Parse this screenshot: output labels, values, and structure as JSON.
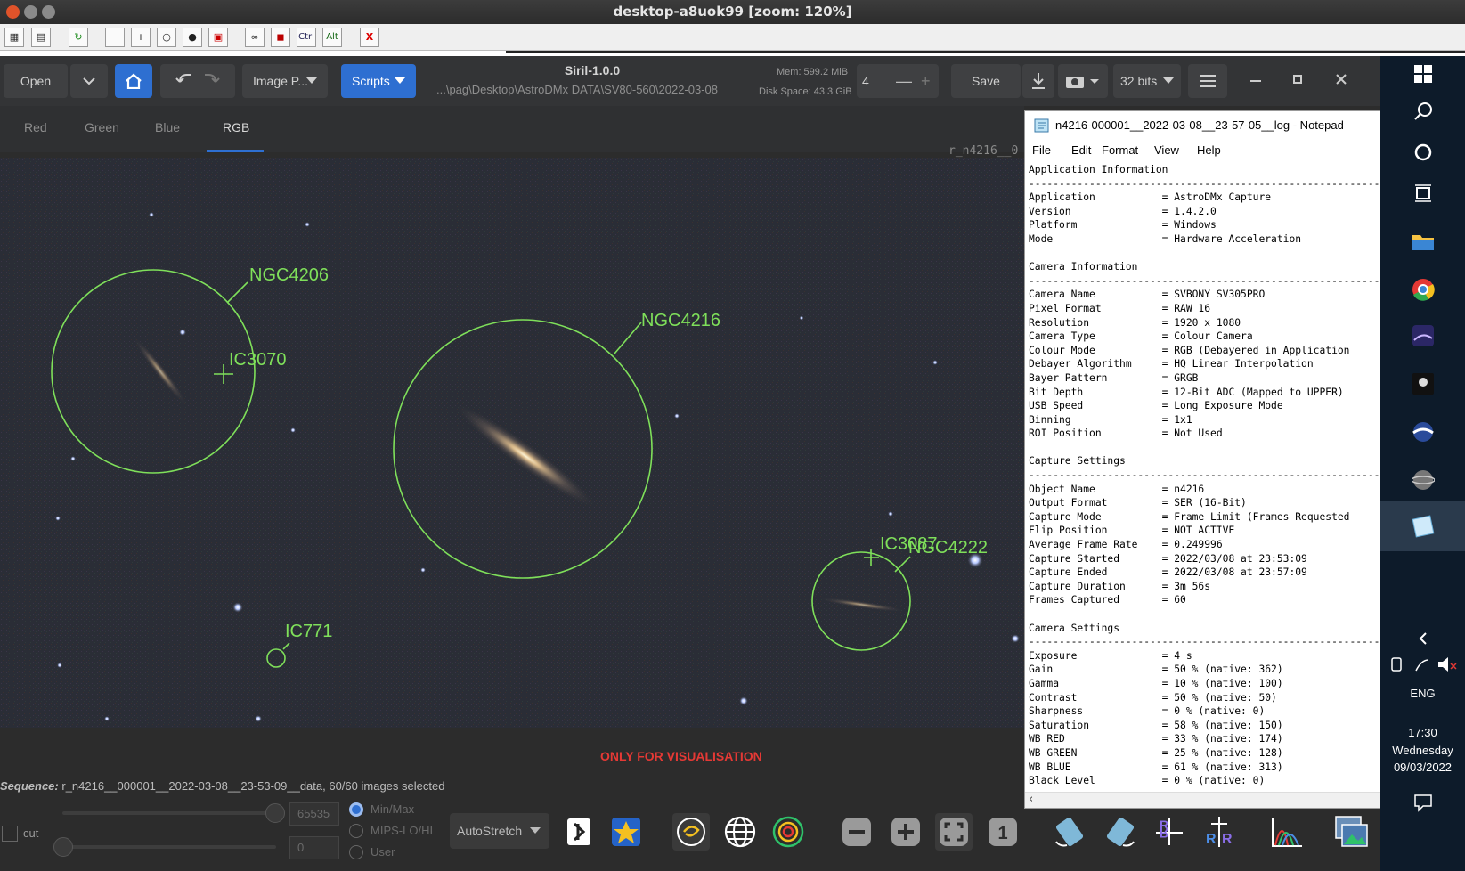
{
  "vnc": {
    "title": "desktop-a8uok99 [zoom: 120%]",
    "toolbar": [
      "clipboard-icon",
      "file-icon",
      "refresh-icon",
      "zoom-out-icon",
      "zoom-in-icon",
      "zoom-fit-icon",
      "zoom-100-icon",
      "fullscreen-icon",
      "link-icon",
      "screen-icon"
    ],
    "ctrl": "Ctrl",
    "alt": "Alt",
    "close": "X"
  },
  "siril": {
    "open": "Open",
    "image_processing": "Image P...",
    "scripts": "Scripts",
    "title": "Siril-1.0.0",
    "path": "...\\pag\\Desktop\\AstroDMx DATA\\SV80-560\\2022-03-08",
    "mem": "Mem: 599.2 MiB",
    "disk": "Disk Space: 43.3 GiB",
    "spin_value": "4",
    "save": "Save",
    "bits": "32 bits",
    "tabs": [
      "Red",
      "Green",
      "Blue",
      "RGB"
    ],
    "image_name": "r_n4216__0",
    "vis_label": "ONLY FOR VISUALISATION",
    "sequence_label": "Sequence:",
    "sequence_text": " r_n4216__000001__2022-03-08__23-53-09__data, 60/60 images selected",
    "max_value": "65535",
    "min_value": "0",
    "minmax": "Min/Max",
    "mips": "MIPS-LO/HI",
    "user": "User",
    "cut": "cut",
    "autostretch": "AutoStretch",
    "one": "1",
    "objects": [
      {
        "name": "NGC4206"
      },
      {
        "name": "IC3070"
      },
      {
        "name": "NGC4216"
      },
      {
        "name": "IC3087"
      },
      {
        "name": "NGC4222"
      },
      {
        "name": "IC771"
      }
    ]
  },
  "notepad": {
    "title": "n4216-000001__2022-03-08__23-57-05__log - Notepad",
    "menu": [
      "File",
      "Edit",
      "Format",
      "View",
      "Help"
    ],
    "lines": [
      "Application Information",
      "------------------------------------------------------------",
      "Application           = AstroDMx Capture",
      "Version               = 1.4.2.0",
      "Platform              = Windows",
      "Mode                  = Hardware Acceleration",
      "",
      "Camera Information",
      "------------------------------------------------------------",
      "Camera Name           = SVBONY SV305PRO",
      "Pixel Format          = RAW 16",
      "Resolution            = 1920 x 1080",
      "Camera Type           = Colour Camera",
      "Colour Mode           = RGB (Debayered in Application",
      "Debayer Algorithm     = HQ Linear Interpolation",
      "Bayer Pattern         = GRGB",
      "Bit Depth             = 12-Bit ADC (Mapped to UPPER)",
      "USB Speed             = Long Exposure Mode",
      "Binning               = 1x1",
      "ROI Position          = Not Used",
      "",
      "Capture Settings",
      "------------------------------------------------------------",
      "Object Name           = n4216",
      "Output Format         = SER (16-Bit)",
      "Capture Mode          = Frame Limit (Frames Requested",
      "Flip Position         = NOT ACTIVE",
      "Average Frame Rate    = 0.249996",
      "Capture Started       = 2022/03/08 at 23:53:09",
      "Capture Ended         = 2022/03/08 at 23:57:09",
      "Capture Duration      = 3m 56s",
      "Frames Captured       = 60",
      "",
      "Camera Settings",
      "------------------------------------------------------------",
      "Exposure              = 4 s",
      "Gain                  = 50 % (native: 362)",
      "Gamma                 = 10 % (native: 100)",
      "Contrast              = 50 % (native: 50)",
      "Sharpness             = 0 % (native: 0)",
      "Saturation            = 58 % (native: 150)",
      "WB RED                = 33 % (native: 174)",
      "WB GREEN              = 25 % (native: 128)",
      "WB BLUE               = 61 % (native: 313)",
      "Black Level           = 0 % (native: 0)"
    ]
  },
  "taskbar": {
    "lang": "ENG",
    "time": "17:30",
    "day": "Wednesday",
    "date": "09/03/2022"
  }
}
